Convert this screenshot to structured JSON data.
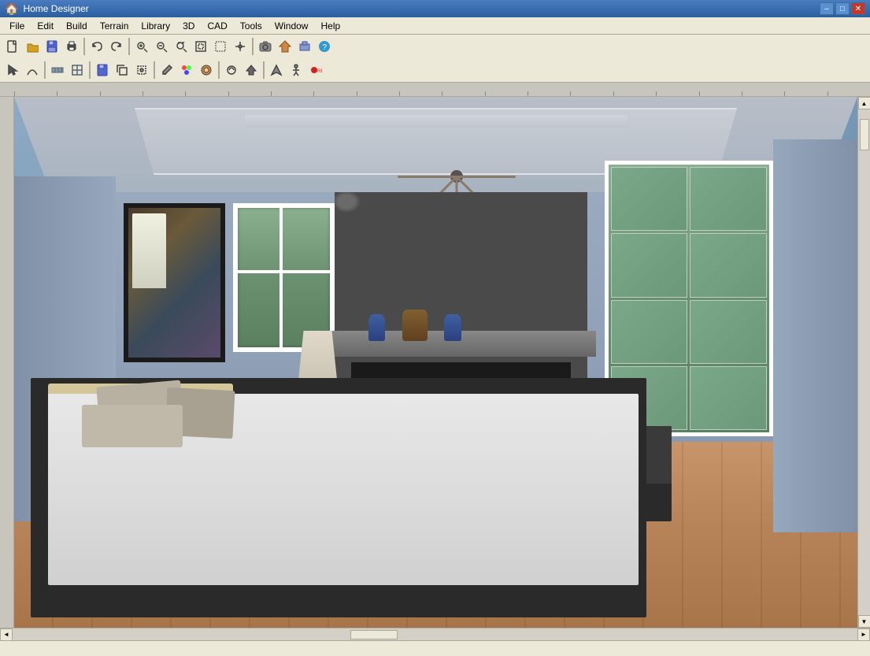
{
  "window": {
    "title": "Home Designer",
    "icon": "🏠"
  },
  "titlebar": {
    "minimize_label": "–",
    "maximize_label": "□",
    "close_label": "✕"
  },
  "menubar": {
    "items": [
      {
        "id": "file",
        "label": "File"
      },
      {
        "id": "edit",
        "label": "Edit"
      },
      {
        "id": "build",
        "label": "Build"
      },
      {
        "id": "terrain",
        "label": "Terrain"
      },
      {
        "id": "library",
        "label": "Library"
      },
      {
        "id": "3d",
        "label": "3D"
      },
      {
        "id": "cad",
        "label": "CAD"
      },
      {
        "id": "tools",
        "label": "Tools"
      },
      {
        "id": "window",
        "label": "Window"
      },
      {
        "id": "help",
        "label": "Help"
      }
    ]
  },
  "toolbar1": {
    "buttons": [
      {
        "id": "new",
        "icon": "📄",
        "tooltip": "New"
      },
      {
        "id": "open",
        "icon": "📂",
        "tooltip": "Open"
      },
      {
        "id": "save",
        "icon": "💾",
        "tooltip": "Save"
      },
      {
        "id": "print",
        "icon": "🖨",
        "tooltip": "Print"
      },
      {
        "id": "undo",
        "icon": "↩",
        "tooltip": "Undo"
      },
      {
        "id": "redo",
        "icon": "↪",
        "tooltip": "Redo"
      },
      {
        "id": "zoom-in",
        "icon": "🔍",
        "tooltip": "Zoom In"
      },
      {
        "id": "zoom-out",
        "icon": "🔎",
        "tooltip": "Zoom Out"
      },
      {
        "id": "fit",
        "icon": "⊞",
        "tooltip": "Fit to Screen"
      }
    ]
  },
  "statusbar": {
    "text": ""
  }
}
